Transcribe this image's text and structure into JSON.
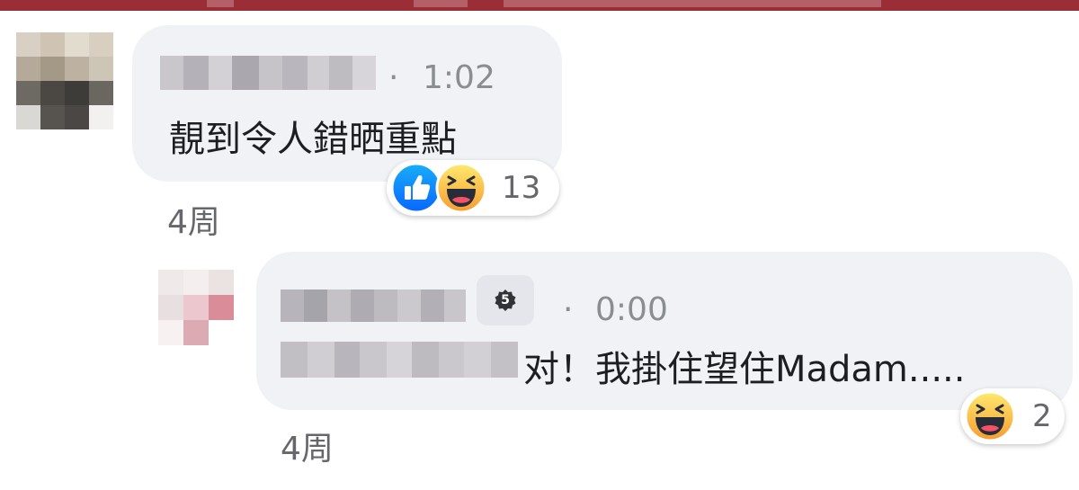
{
  "comments": [
    {
      "time": "1:02",
      "text": "靚到令人錯晒重點",
      "reaction_count": "13",
      "age": "4周",
      "reactions": [
        "like-icon",
        "haha-icon"
      ]
    }
  ],
  "reply": {
    "badge": "5",
    "time": "0:00",
    "text": "对！我掛住望住Madam.....",
    "reaction_count": "2",
    "age": "4周",
    "reactions": [
      "haha-icon"
    ]
  },
  "separator": "·",
  "colors": {
    "banner": "#9b2d37",
    "bubble": "#f0f2f5",
    "like_blue": "#1877f2",
    "haha_yellow": "#f7b928"
  }
}
